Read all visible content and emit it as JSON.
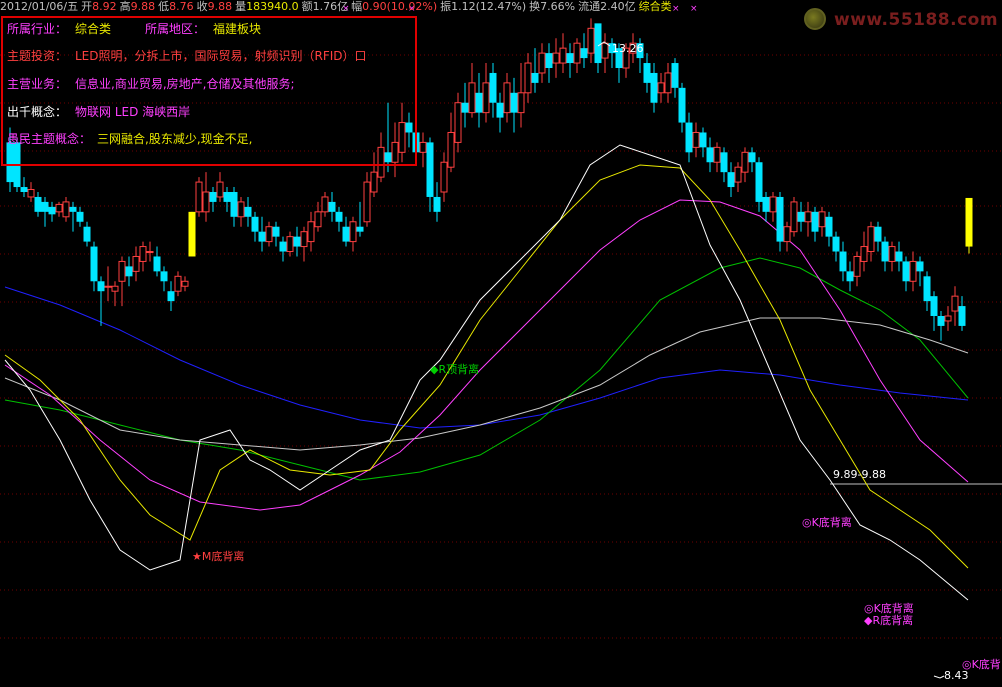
{
  "header": {
    "date": "2012/01/06/五",
    "open_label": "开",
    "open": "8.92",
    "high_label": "高",
    "high": "9.88",
    "low_label": "低",
    "low": "8.76",
    "close_label": "收",
    "close": "9.88",
    "volume_label": "量",
    "volume": "183940.0",
    "amount_label": "额",
    "amount": "1.76亿",
    "change_label": "幅",
    "change": "0.90(10.02%)",
    "amplitude_label": "振",
    "amplitude": "1.12(12.47%)",
    "turnover_label": "换",
    "turnover": "7.66%",
    "float_label": "流通",
    "float": "2.40亿",
    "sector": "综合类"
  },
  "info": {
    "industry_label": "所属行业：",
    "industry": "综合类",
    "region_label": "所属地区：",
    "region": "福建板块",
    "theme_label": "主题投资：",
    "theme": "LED照明，分拆上市，国际贸易，射频识别（RFID）口",
    "business_label": "主营业务：",
    "business": "信息业,商业贸易,房地产,仓储及其他服务;",
    "concept_label": "出千概念：",
    "concept": "物联网 LED 海峡西岸",
    "user_concept_label": "愚民主题概念：",
    "user_concept": "三网融合,股东减少,现金不足,"
  },
  "logo": {
    "text": "www.55188.com"
  },
  "annotations": {
    "peak_high": "13.26",
    "period_low": "8.43",
    "range": "9.89-9.88",
    "m_divergence": "★M底背离",
    "r_top_divergence": "◆R顶背离",
    "k_divergence_1": "◎K底背离",
    "k_divergence_2": "◎K底背离",
    "r_divergence": "◆R底背离",
    "k_divergence_3": "◎K底背"
  },
  "colors": {
    "up": "#ff4040",
    "down": "#00e5ff",
    "limit_up": "#ffff00",
    "ma_white": "#ffffff",
    "ma_yellow": "#e8e800",
    "ma_magenta": "#ff40ff",
    "ma_green": "#00c000",
    "ma_gray": "#c8c8c8",
    "ma_blue": "#2020ff",
    "grid": "#700000",
    "frame": "#e00000"
  },
  "chart_data": {
    "type": "candlestick",
    "price_high": 13.26,
    "price_low": 8.43,
    "last_close": 9.88,
    "grid": "dotted"
  }
}
